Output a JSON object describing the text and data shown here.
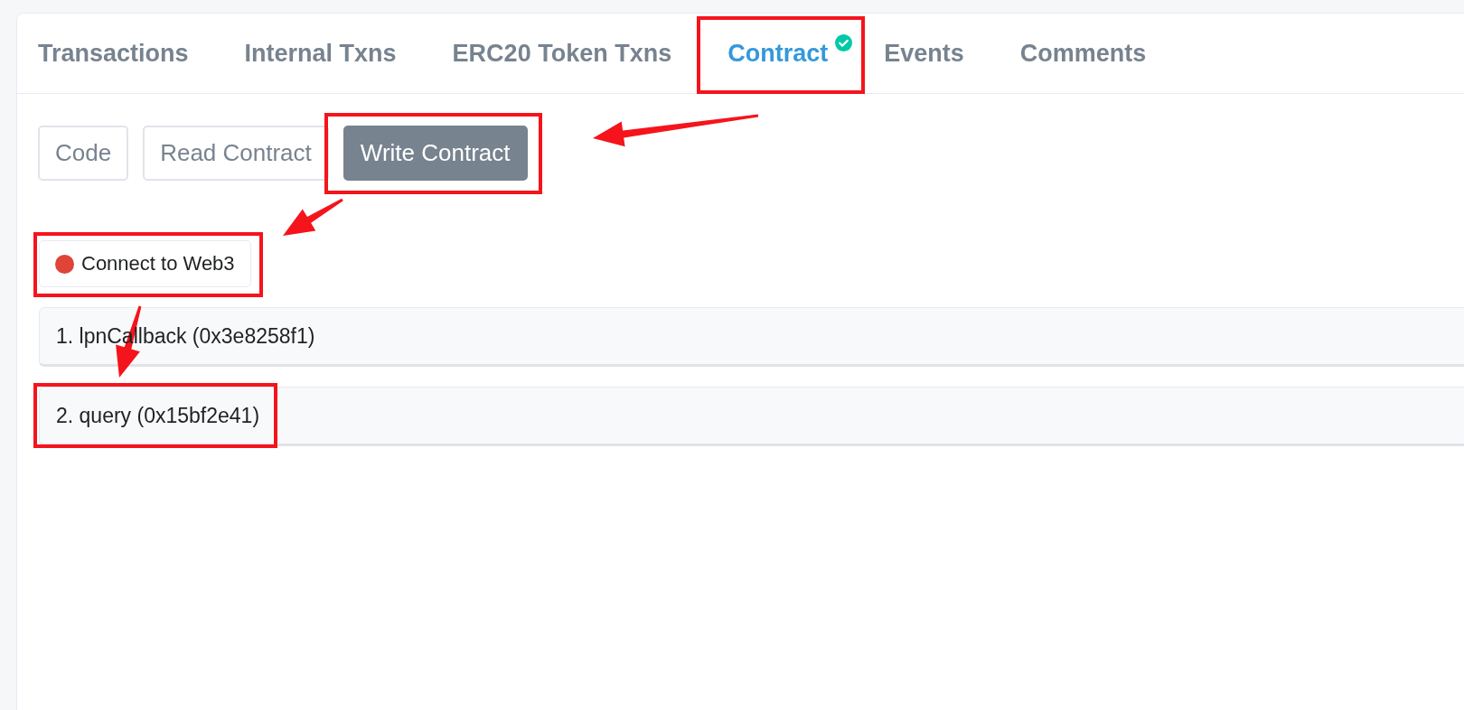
{
  "tabs": [
    {
      "label": "Transactions",
      "selected": false,
      "verified": false,
      "highlighted": false
    },
    {
      "label": "Internal Txns",
      "selected": false,
      "verified": false,
      "highlighted": false
    },
    {
      "label": "ERC20 Token Txns",
      "selected": false,
      "verified": false,
      "highlighted": false
    },
    {
      "label": "Contract",
      "selected": true,
      "verified": true,
      "highlighted": true
    },
    {
      "label": "Events",
      "selected": false,
      "verified": false,
      "highlighted": false
    },
    {
      "label": "Comments",
      "selected": false,
      "verified": false,
      "highlighted": false
    }
  ],
  "subtabs": [
    {
      "label": "Code",
      "selected": false,
      "highlighted": false
    },
    {
      "label": "Read Contract",
      "selected": false,
      "highlighted": false
    },
    {
      "label": "Write Contract",
      "selected": true,
      "highlighted": true
    }
  ],
  "connect_button": {
    "label": "Connect to Web3",
    "color": "#de4437",
    "highlighted": true
  },
  "functions": [
    {
      "label": "1. lpnCallback (0x3e8258f1)",
      "highlighted": false
    },
    {
      "label": "2. query (0x15bf2e41)",
      "highlighted": true
    }
  ]
}
